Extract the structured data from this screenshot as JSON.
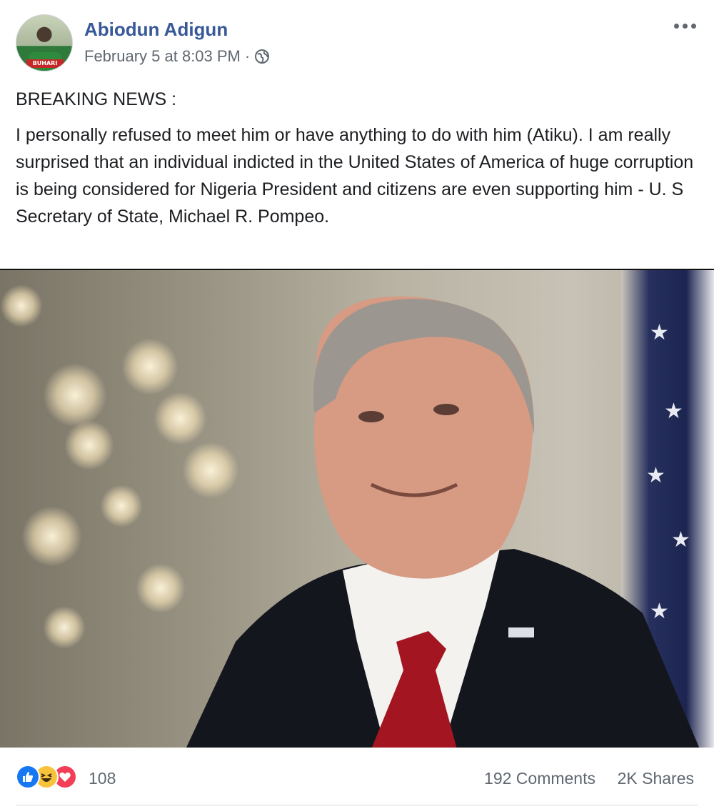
{
  "post": {
    "author": "Abiodun Adigun",
    "timestamp": "February 5 at 8:03 PM",
    "separator": "·",
    "privacy_icon": "globe-icon",
    "more_icon": "more-options-icon",
    "avatar_badge": "BUHARI",
    "paragraphs": [
      "BREAKING NEWS :",
      "I personally refused to meet him or have anything to do with him (Atiku). I am really surprised that an individual indicted in the United States of America of huge corruption is being considered for Nigeria President and citizens are even supporting him - U. S Secretary of State, Michael R. Pompeo."
    ]
  },
  "engagement": {
    "reaction_icons": [
      "like-icon",
      "haha-icon",
      "love-icon"
    ],
    "reaction_count": "108",
    "comments": "192 Comments",
    "shares": "2K Shares"
  },
  "colors": {
    "author_link": "#385898",
    "meta_text": "#606770",
    "like": "#1877f2",
    "haha": "#f7c33b",
    "love": "#f33e58"
  }
}
